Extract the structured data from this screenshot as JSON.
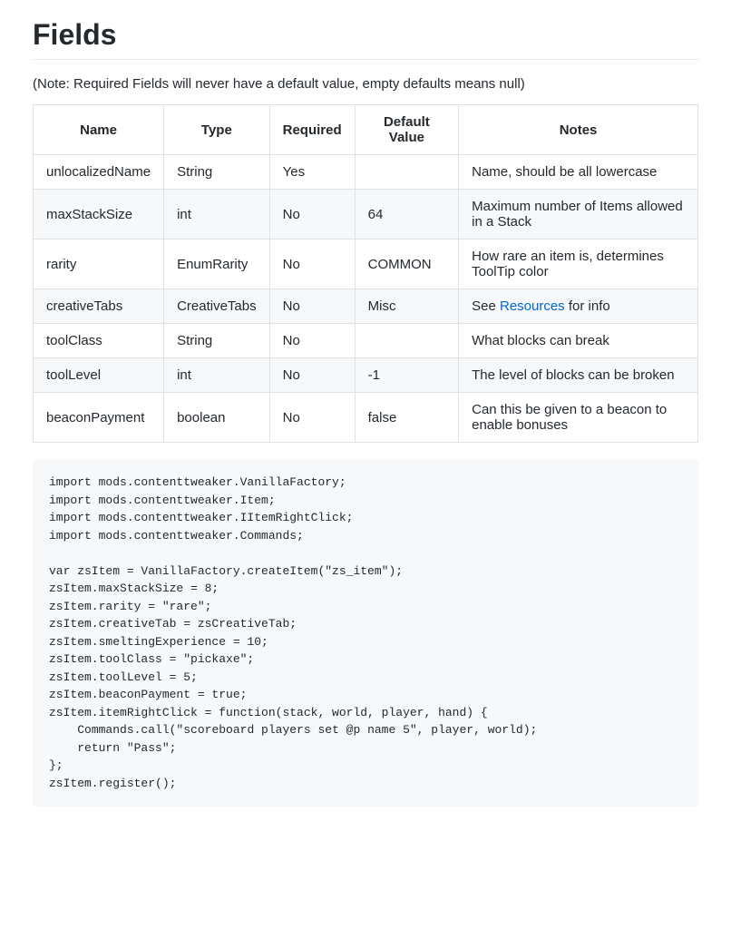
{
  "heading": "Fields",
  "note": "(Note: Required Fields will never have a default value, empty defaults means null)",
  "table": {
    "headers": [
      "Name",
      "Type",
      "Required",
      "Default Value",
      "Notes"
    ],
    "rows": [
      {
        "name": "unlocalizedName",
        "type": "String",
        "required": "Yes",
        "default": "",
        "notes_prefix": "Name, should be all lowercase",
        "notes_link": "",
        "notes_suffix": ""
      },
      {
        "name": "maxStackSize",
        "type": "int",
        "required": "No",
        "default": "64",
        "notes_prefix": "Maximum number of Items allowed in a Stack",
        "notes_link": "",
        "notes_suffix": ""
      },
      {
        "name": "rarity",
        "type": "EnumRarity",
        "required": "No",
        "default": "COMMON",
        "notes_prefix": "How rare an item is, determines ToolTip color",
        "notes_link": "",
        "notes_suffix": ""
      },
      {
        "name": "creativeTabs",
        "type": "CreativeTabs",
        "required": "No",
        "default": "Misc",
        "notes_prefix": "See ",
        "notes_link": "Resources",
        "notes_suffix": " for info"
      },
      {
        "name": "toolClass",
        "type": "String",
        "required": "No",
        "default": "",
        "notes_prefix": "What blocks can break",
        "notes_link": "",
        "notes_suffix": ""
      },
      {
        "name": "toolLevel",
        "type": "int",
        "required": "No",
        "default": "-1",
        "notes_prefix": "The level of blocks can be broken",
        "notes_link": "",
        "notes_suffix": ""
      },
      {
        "name": "beaconPayment",
        "type": "boolean",
        "required": "No",
        "default": "false",
        "notes_prefix": "Can this be given to a beacon to enable bonuses",
        "notes_link": "",
        "notes_suffix": ""
      }
    ]
  },
  "code": "import mods.contenttweaker.VanillaFactory;\nimport mods.contenttweaker.Item;\nimport mods.contenttweaker.IItemRightClick;\nimport mods.contenttweaker.Commands;\n\nvar zsItem = VanillaFactory.createItem(\"zs_item\");\nzsItem.maxStackSize = 8;\nzsItem.rarity = \"rare\";\nzsItem.creativeTab = zsCreativeTab;\nzsItem.smeltingExperience = 10;\nzsItem.toolClass = \"pickaxe\";\nzsItem.toolLevel = 5;\nzsItem.beaconPayment = true;\nzsItem.itemRightClick = function(stack, world, player, hand) {\n    Commands.call(\"scoreboard players set @p name 5\", player, world);\n    return \"Pass\";\n};\nzsItem.register();"
}
